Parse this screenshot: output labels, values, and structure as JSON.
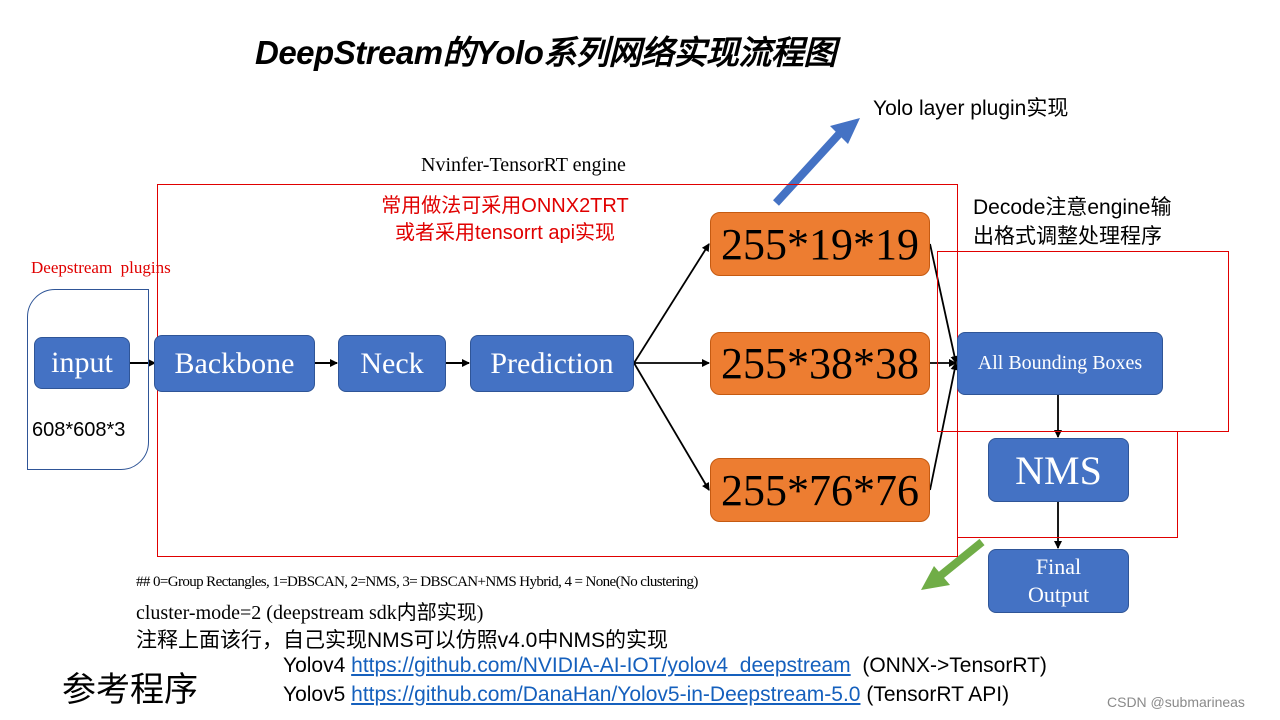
{
  "title": "DeepStream的Yolo系列网络实现流程图",
  "labels": {
    "yolo_layer_plugin": "Yolo layer plugin实现",
    "nvinfer_engine": "Nvinfer-TensorRT engine",
    "onnx_note_line1": "常用做法可采用ONNX2TRT",
    "onnx_note_line2": "或者采用tensorrt api实现",
    "decode_note_line1": "Decode注意engine输",
    "decode_note_line2": "出格式调整处理程序",
    "deepstream_plugins": "Deepstream  plugins",
    "input_dims": "608*608*3"
  },
  "nodes": {
    "input": "input",
    "backbone": "Backbone",
    "neck": "Neck",
    "prediction": "Prediction",
    "out_small": "255*19*19",
    "out_medium": "255*38*38",
    "out_large": "255*76*76",
    "all_boxes": "All Bounding Boxes",
    "nms": "NMS",
    "final_line1": "Final",
    "final_line2": "Output"
  },
  "notes": {
    "cluster_options": "## 0=Group Rectangles, 1=DBSCAN, 2=NMS, 3= DBSCAN+NMS Hybrid, 4 = None(No clustering)",
    "cluster_mode": "cluster-mode=2 (deepstream sdk内部实现)",
    "comment_line": "注释上面该行，自己实现NMS可以仿照v4.0中NMS的实现"
  },
  "references": {
    "heading": "参考程序",
    "items": [
      {
        "name": "Yolov4",
        "url": "https://github.com/NVIDIA-AI-IOT/yolov4_deepstream",
        "suffix": "(ONNX->TensorRT)"
      },
      {
        "name": "Yolov5",
        "url": "https://github.com/DanaHan/Yolov5-in-Deepstream-5.0",
        "suffix": "(TensorRT API)"
      }
    ]
  },
  "watermark": "CSDN @submarineas",
  "colors": {
    "node_blue": "#4472c4",
    "node_orange": "#ed7d31",
    "frame_red": "#e00000",
    "arrow_blue": "#4472c4",
    "arrow_green": "#70ad47",
    "link_blue": "#1560bd"
  }
}
